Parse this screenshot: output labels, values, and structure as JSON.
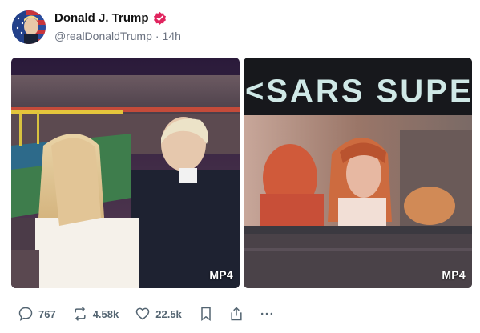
{
  "post": {
    "author": {
      "display_name": "Donald J. Trump",
      "handle": "@realDonaldTrump",
      "separator": "·",
      "time": "14h",
      "verified_color": "#e0245e"
    },
    "media": [
      {
        "type_label": "MP4"
      },
      {
        "type_label": "MP4",
        "overlay_text": "<SARS SUPER"
      }
    ],
    "actions": {
      "replies": "767",
      "reposts": "4.58k",
      "likes": "22.5k"
    }
  },
  "icons": {
    "reply": "comment-icon",
    "repost": "repost-icon",
    "like": "heart-icon",
    "bookmark": "bookmark-icon",
    "share": "share-icon",
    "more": "more-icon"
  }
}
